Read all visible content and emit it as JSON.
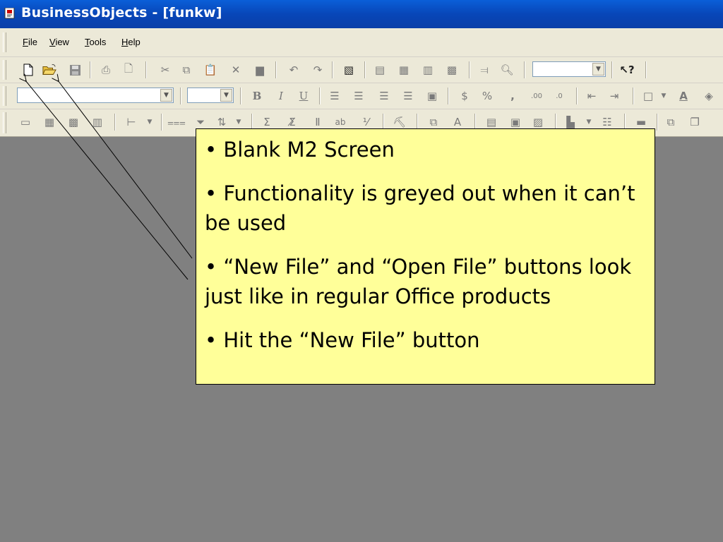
{
  "window": {
    "title": "BusinessObjects - [funkw]"
  },
  "menu": [
    {
      "label": "File",
      "key": "F",
      "rest": "ile"
    },
    {
      "label": "View",
      "key": "V",
      "rest": "iew"
    },
    {
      "label": "Tools",
      "key": "T",
      "rest": "ools"
    },
    {
      "label": "Help",
      "key": "H",
      "rest": "elp"
    }
  ],
  "callout": {
    "bullets": [
      "• Blank M2 Screen",
      "• Functionality is greyed out when it can’t be used",
      "• “New File” and “Open File” buttons look just like in regular Office products",
      "• Hit the “New File” button"
    ]
  },
  "colors": {
    "titlebar": "#0a5fd8",
    "toolbar": "#ece9d8",
    "workspace": "#808080",
    "callout": "#ffff99"
  },
  "icons": {
    "toolbar1": [
      "new-file-icon",
      "open-file-icon",
      "save-icon",
      "print-icon",
      "print-preview-icon",
      "cut-icon",
      "copy-icon",
      "paste-icon",
      "delete-icon",
      "clipboard-icon",
      "undo-icon",
      "redo-icon",
      "edit-report-icon",
      "table-icon",
      "crosstab-icon",
      "chart-icon",
      "grid-icon",
      "insert-icon",
      "zoom-icon",
      "help-pointer-icon"
    ],
    "toolbar2": [
      "bold-icon",
      "italic-icon",
      "underline-icon",
      "align-left-icon",
      "align-center-icon",
      "align-right-icon",
      "justify-icon",
      "merge-icon",
      "currency-icon",
      "percent-icon",
      "comma-icon",
      "increase-decimal-icon",
      "decrease-decimal-icon",
      "outdent-icon",
      "indent-icon",
      "border-icon",
      "font-color-icon",
      "fill-color-icon"
    ],
    "toolbar3": [
      "report-icon",
      "section-icon",
      "break-icon",
      "ranking-icon",
      "sort-icon",
      "filter-icon",
      "sort-asc-icon",
      "sum-icon",
      "calc-icon",
      "variable-icon",
      "text-icon",
      "slice-icon",
      "drill-icon",
      "alerter-icon",
      "format-icon",
      "data-icon",
      "chart-type-icon",
      "list-icon",
      "briefcase-icon",
      "copy-report-icon"
    ]
  }
}
